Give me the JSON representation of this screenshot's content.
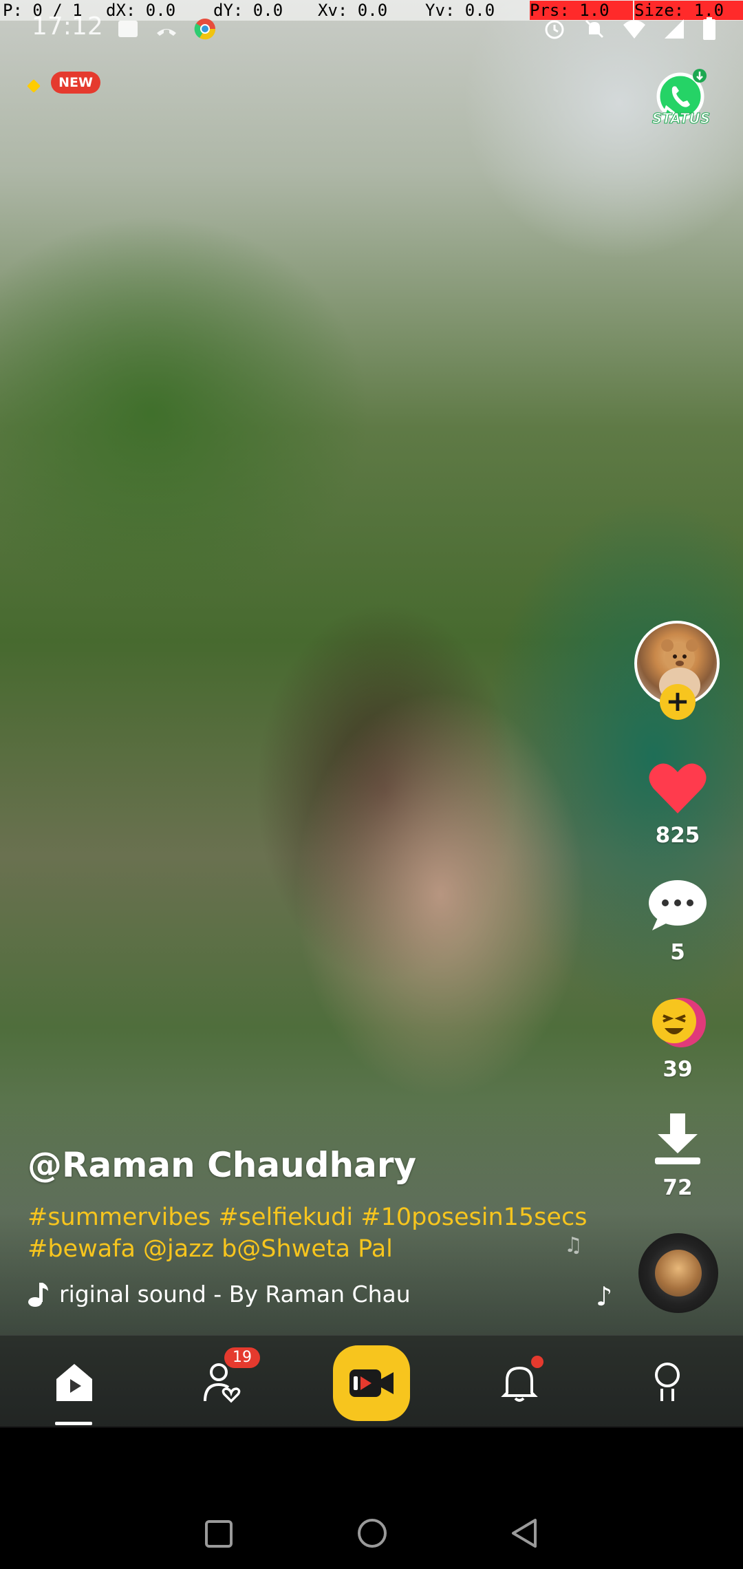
{
  "debug_overlay": {
    "pointer": "P: 0 / 1",
    "dx": "dX: 0.0",
    "dy": "dY: 0.0",
    "xv": "Xv: 0.0",
    "yv": "Yv: 0.0",
    "prs": "Prs: 1.0",
    "size": "Size: 1.0"
  },
  "status_bar": {
    "time": "17:12"
  },
  "top": {
    "new_badge": "NEW",
    "whatsapp_status_label": "STATUS"
  },
  "actions": {
    "likes": "825",
    "comments": "5",
    "reactions": "39",
    "downloads": "72"
  },
  "caption": {
    "username": "@Raman Chaudhary",
    "hashtags": "#summervibes #selfiekudi #10posesin15secs #bewafa @jazz b@Shweta Pal",
    "music": "riginal sound - By Raman Chau"
  },
  "bottom_nav": {
    "items": [
      {
        "name": "home",
        "icon": "home-play-icon"
      },
      {
        "name": "following",
        "icon": "person-heart-icon",
        "badge": "19"
      },
      {
        "name": "create",
        "icon": "video-camera-icon"
      },
      {
        "name": "notifications",
        "icon": "bell-icon"
      },
      {
        "name": "profile",
        "icon": "person-icon"
      }
    ]
  },
  "colors": {
    "accent": "#f7c51e",
    "badge_red": "#e53a2e",
    "like_red": "#ff3b4d"
  }
}
